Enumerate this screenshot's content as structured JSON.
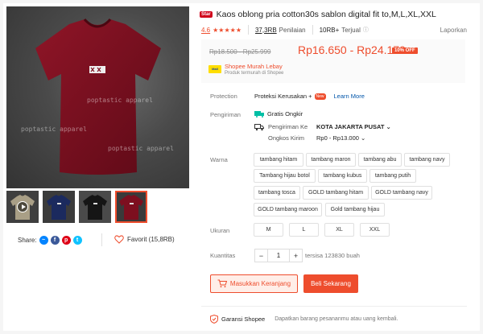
{
  "product": {
    "badge": "Star",
    "title": "Kaos oblong pria cotton30s sablon digital fit to,M,L,XL,XXL",
    "rating": "4.6",
    "ratings_count": "37,3RB",
    "ratings_label": "Penilaian",
    "sold": "10RB+",
    "sold_label": "Terjual",
    "report": "Laporkan"
  },
  "image": {
    "watermark": "poptastic apparel",
    "shirt_color": "#7d0f1f",
    "thumbnails": [
      {
        "name": "thumb-video",
        "color": "#a99f86",
        "bg": "#3f3f3f",
        "video": true,
        "selected": false
      },
      {
        "name": "thumb-navy",
        "color": "#1b2a5e",
        "bg": "#3b3b3b",
        "video": false,
        "selected": false
      },
      {
        "name": "thumb-black",
        "color": "#151515",
        "bg": "#4a4a4a",
        "video": false,
        "selected": false
      },
      {
        "name": "thumb-maroon",
        "color": "#7d0f1f",
        "bg": "#3a3a3a",
        "video": false,
        "selected": true
      }
    ]
  },
  "share": {
    "label": "Share:",
    "favorite": "Favorit (15,8RB)",
    "icons": [
      "messenger-icon",
      "facebook-icon",
      "pinterest-icon",
      "twitter-icon"
    ]
  },
  "pricing": {
    "original": "Rp18.500 - Rp25.999",
    "current": "Rp16.650 - Rp24.179",
    "discount": "10% OFF",
    "promo_logo": "Mall",
    "promo_name": "Shopee Murah Lebay",
    "promo_sub": "Produk termurah di Shopee"
  },
  "protection": {
    "label": "Protection",
    "value": "Proteksi Kerusakan +",
    "badge": "New",
    "link": "Learn More"
  },
  "shipping": {
    "label": "Pengiriman",
    "free": "Gratis Ongkir",
    "to_label": "Pengiriman Ke",
    "to_value": "KOTA JAKARTA PUSAT",
    "cost_label": "Ongkos Kirim",
    "cost_value": "Rp0 - Rp13.000"
  },
  "variants": {
    "color_label": "Warna",
    "colors": [
      "tambang hitam",
      "tambang maron",
      "tambang abu",
      "tambang navy",
      "Tambang hijau botol",
      "tambang kubus",
      "tambang putih",
      "tambang tosca",
      "GOLD tambang hitam",
      "GOLD tambang navy",
      "GOLD tambang maroon",
      "Gold tambang hijau"
    ],
    "size_label": "Ukuran",
    "sizes": [
      "M",
      "L",
      "XL",
      "XXL"
    ]
  },
  "quantity": {
    "label": "Kuantitas",
    "value": "1",
    "stock": "tersisa 123830 buah"
  },
  "actions": {
    "add_to_cart": "Masukkan Keranjang",
    "buy_now": "Beli Sekarang"
  },
  "guarantee": {
    "label": "Garansi Shopee",
    "text": "Dapatkan barang pesananmu atau uang kembali."
  },
  "colors": {
    "accent": "#ee4d2d",
    "link": "#0055aa",
    "free_shipping": "#00bfa5"
  }
}
